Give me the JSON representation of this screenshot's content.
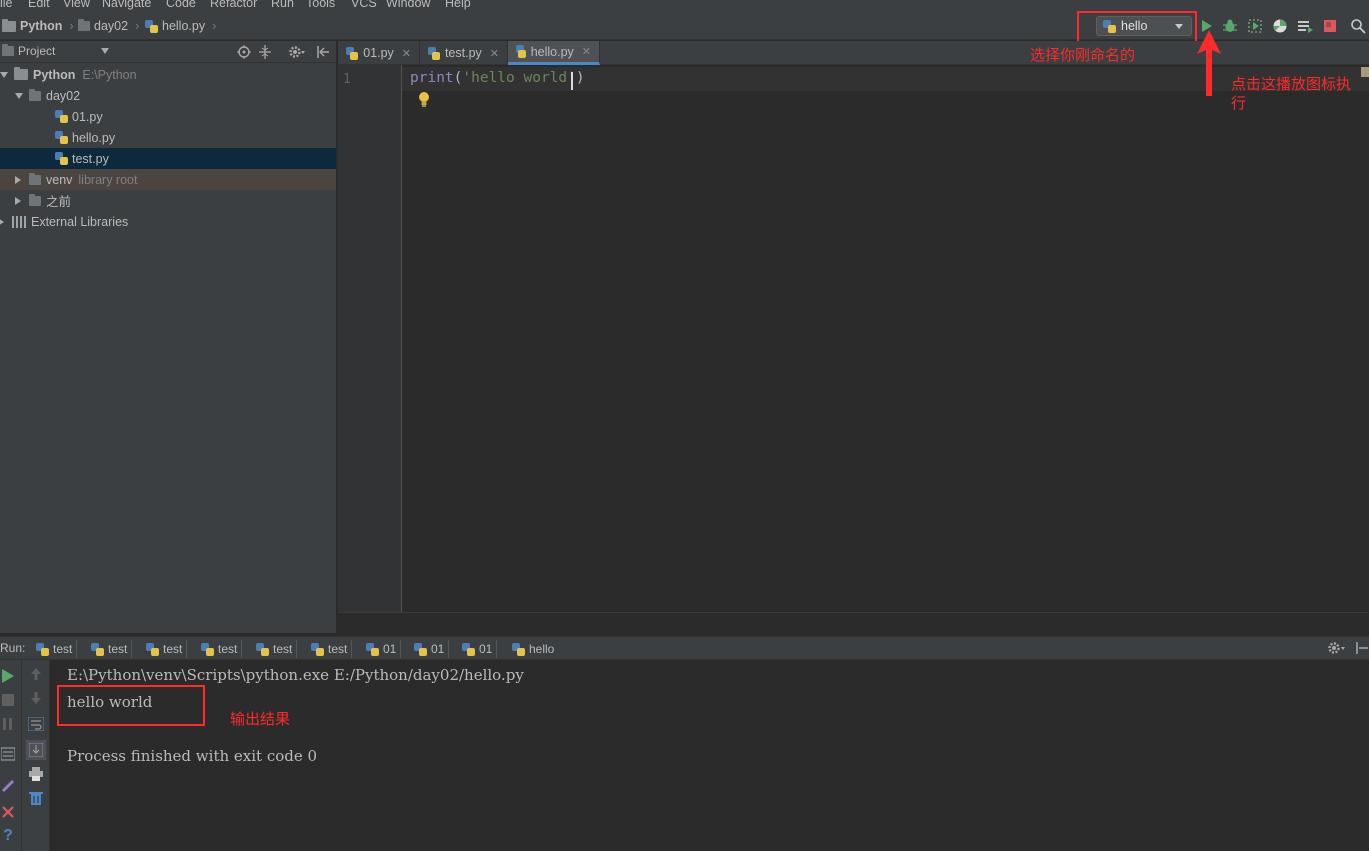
{
  "menu": [
    "ile",
    "Edit",
    "View",
    "Navigate",
    "Code",
    "Refactor",
    "Run",
    "Tools",
    "VCS",
    "Window",
    "Help"
  ],
  "breadcrumb": [
    "Python",
    "day02",
    "hello.py"
  ],
  "run_config": {
    "name": "hello"
  },
  "project_header": {
    "label": "Project"
  },
  "tree": {
    "root": {
      "name": "Python",
      "path": "E:\\Python"
    },
    "day02": "day02",
    "files": [
      "01.py",
      "hello.py",
      "test.py"
    ],
    "venv": {
      "name": "venv",
      "note": "library root"
    },
    "before": "之前",
    "external": "External Libraries"
  },
  "tabs": [
    "01.py",
    "test.py",
    "hello.py"
  ],
  "editor": {
    "line_number": "1",
    "code": {
      "func": "print",
      "paren_open": "(",
      "string": "'hello world'",
      "paren_close": ")"
    }
  },
  "run_panel": {
    "label": "Run:",
    "tabs": [
      "test",
      "test",
      "test",
      "test",
      "test",
      "test",
      "01",
      "01",
      "01",
      "hello"
    ],
    "console": {
      "command": "E:\\Python\\venv\\Scripts\\python.exe E:/Python/day02/hello.py",
      "output": "hello world",
      "finish": "Process finished with exit code 0"
    }
  },
  "annotations": {
    "select_config": "选择你刚命名的",
    "click_play_1": "点击这播放图标执",
    "click_play_2": "行",
    "output_result": "输出结果"
  },
  "colors": {
    "annotation": "#ff2a2a",
    "run_green": "#59a869",
    "accent": "#4a88c7"
  }
}
